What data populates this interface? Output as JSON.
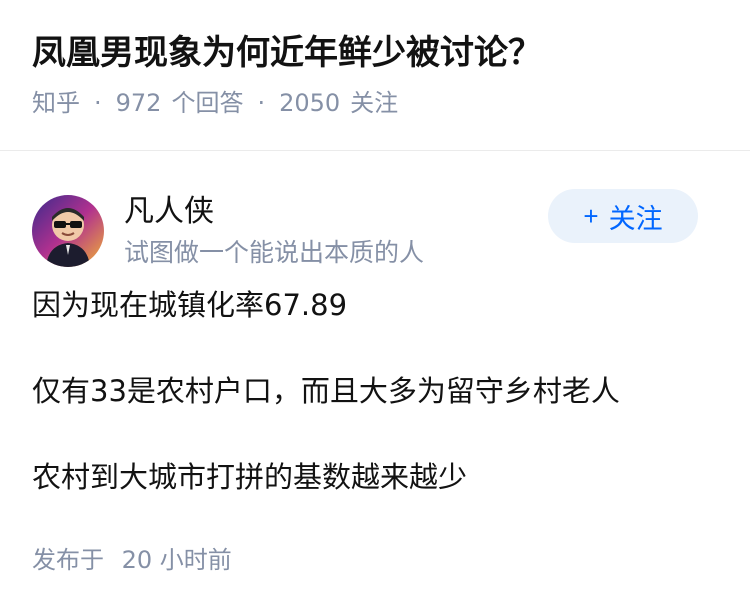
{
  "question": {
    "title": "凤凰男现象为何近年鲜少被讨论？",
    "source": "知乎",
    "separator": "·",
    "answer_count": "972",
    "answer_label": "个回答",
    "follower_count": "2050",
    "follower_label": "关注"
  },
  "author": {
    "name": "凡人侠",
    "bio": "试图做一个能说出本质的人",
    "follow_icon": "+",
    "follow_label": "关注",
    "accent_color": "#0066ff"
  },
  "answer": {
    "paragraphs": [
      "因为现在城镇化率67.89",
      "仅有33是农村户口，而且大多为留守乡村老人",
      "农村到大城市打拼的基数越来越少"
    ],
    "posted_label": "发布于",
    "posted_time": "20 小时前"
  }
}
